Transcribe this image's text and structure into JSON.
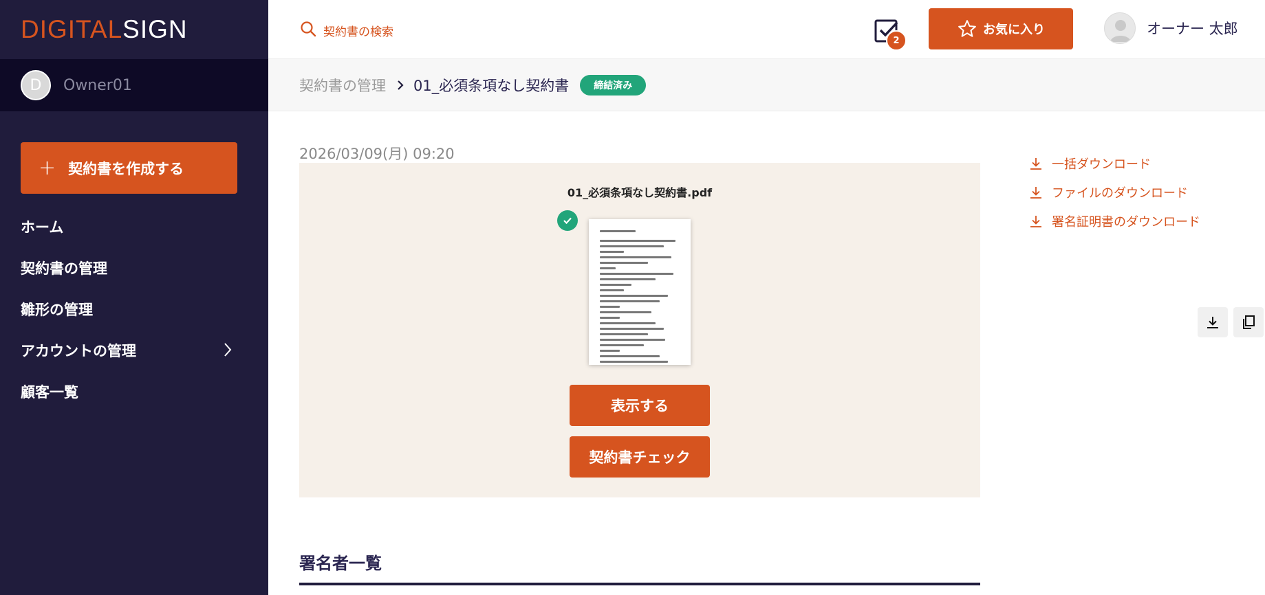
{
  "brand": {
    "logo_accent": "DIGITAL",
    "logo_light": "SIGN",
    "accent_color": "#d6541f",
    "sidebar_color": "#201c3c"
  },
  "sidebar": {
    "account_initial": "D",
    "account_name": "Owner01",
    "create_button": {
      "icon": "plus-icon",
      "label": "契約書を作成する"
    },
    "items": [
      {
        "label": "ホーム"
      },
      {
        "label": "契約書の管理"
      },
      {
        "label": "雛形の管理"
      },
      {
        "label": "アカウントの管理",
        "icon": "chevron-right-icon"
      },
      {
        "label": "顧客一覧"
      }
    ]
  },
  "header": {
    "search_placeholder": "契約書の検索",
    "tasks_badge": "2",
    "favorite_button": "お気に入り",
    "user_name": "オーナー 太郎"
  },
  "breadcrumb": {
    "parent": "契約書の管理",
    "current": "01_必須条項なし契約書",
    "status": "締結済み",
    "status_color": "#22a57a"
  },
  "document": {
    "date": "2026/03/09(月) 09:20",
    "file_name": "01_必須条項なし契約書.pdf",
    "view_button": "表示する",
    "check_button": "契約書チェック"
  },
  "downloads": [
    {
      "label": "一括ダウンロード",
      "icon": "download-icon"
    },
    {
      "label": "ファイルのダウンロード",
      "icon": "download-icon"
    },
    {
      "label": "署名証明書のダウンロード",
      "icon": "download-icon"
    }
  ],
  "tools": {
    "download_icon": "tray-download-icon",
    "copy_icon": "copy-icon"
  },
  "signers": {
    "title": "署名者一覧"
  }
}
